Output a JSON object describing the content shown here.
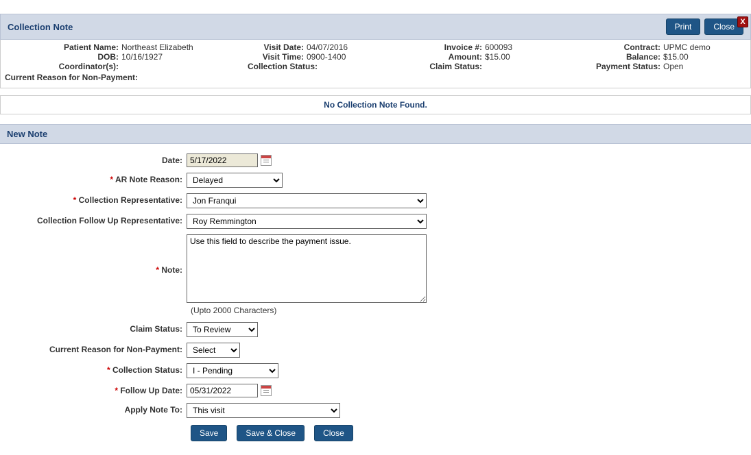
{
  "window": {
    "close_x": "X"
  },
  "header": {
    "title": "Collection Note",
    "print": "Print",
    "close": "Close"
  },
  "info": {
    "patient_name_label": "Patient Name:",
    "patient_name": "Northeast Elizabeth",
    "dob_label": "DOB:",
    "dob": "10/16/1927",
    "coordinators_label": "Coordinator(s):",
    "coordinators": "",
    "visit_date_label": "Visit Date:",
    "visit_date": "04/07/2016",
    "visit_time_label": "Visit Time:",
    "visit_time": "0900-1400",
    "collection_status_label": "Collection Status:",
    "collection_status": "",
    "invoice_label": "Invoice #:",
    "invoice": "600093",
    "amount_label": "Amount:",
    "amount": "$15.00",
    "claim_status_label": "Claim Status:",
    "claim_status": "",
    "contract_label": "Contract:",
    "contract": "UPMC demo",
    "balance_label": "Balance:",
    "balance": "$15.00",
    "payment_status_label": "Payment Status:",
    "payment_status": "Open",
    "nonpay_label": "Current Reason for Non-Payment:",
    "nonpay": ""
  },
  "notfound": "No Collection Note Found.",
  "section": {
    "new_note": "New Note"
  },
  "form": {
    "date_label": "Date:",
    "date_value": "5/17/2022",
    "ar_reason_label": "AR Note Reason:",
    "ar_reason_value": "Delayed",
    "coll_rep_label": "Collection Representative:",
    "coll_rep_value": "Jon Franqui",
    "followup_rep_label": "Collection Follow Up Representative:",
    "followup_rep_value": "Roy Remmington",
    "note_label": "Note:",
    "note_value": "Use this field to describe the payment issue.",
    "note_helper": "(Upto 2000 Characters)",
    "claim_status_label": "Claim Status:",
    "claim_status_value": "To Review",
    "nonpay_label": "Current Reason for Non-Payment:",
    "nonpay_value": "Select",
    "coll_status_label": "Collection Status:",
    "coll_status_value": "I - Pending",
    "followup_date_label": "Follow Up Date:",
    "followup_date_value": "05/31/2022",
    "apply_note_label": "Apply Note To:",
    "apply_note_value": "This visit"
  },
  "actions": {
    "save": "Save",
    "save_close": "Save & Close",
    "close": "Close"
  }
}
